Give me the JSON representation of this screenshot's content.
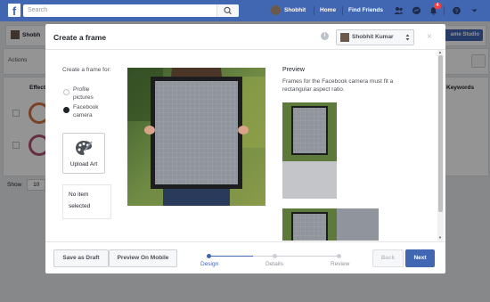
{
  "topbar": {
    "logo": "f",
    "search_placeholder": "Search",
    "user_name": "Shobhit",
    "home_label": "Home",
    "find_friends_label": "Find Friends",
    "notifications_count": "4"
  },
  "background": {
    "page_name": "Shobh",
    "actions_label": "Actions",
    "effects_header": "Effect",
    "keywords_header": "Keywords",
    "frame_studio_label": "ame Studio",
    "show_label": "Show",
    "show_value": "10"
  },
  "modal": {
    "title": "Create a frame",
    "info_icon": "i",
    "page_selector": "Shobhit Kumar",
    "create_for_label": "Create a frame for:",
    "options": [
      {
        "label": "Profile pictures",
        "selected": false
      },
      {
        "label": "Facebook camera",
        "selected": true
      }
    ],
    "upload_label": "Upload Art",
    "no_item_text": "No item selected",
    "preview_title": "Preview",
    "preview_desc": "Frames for the Facebook camera must fit a rectangular aspect ratio.",
    "footer": {
      "save_draft": "Save as Draft",
      "preview_mobile": "Preview On Mobile",
      "steps": [
        "Design",
        "Details",
        "Review"
      ],
      "active_step": 0,
      "back": "Back",
      "next": "Next"
    }
  },
  "colors": {
    "brand": "#4267b2",
    "primary_button": "#4267b2",
    "frame_gray": "#90949c"
  }
}
